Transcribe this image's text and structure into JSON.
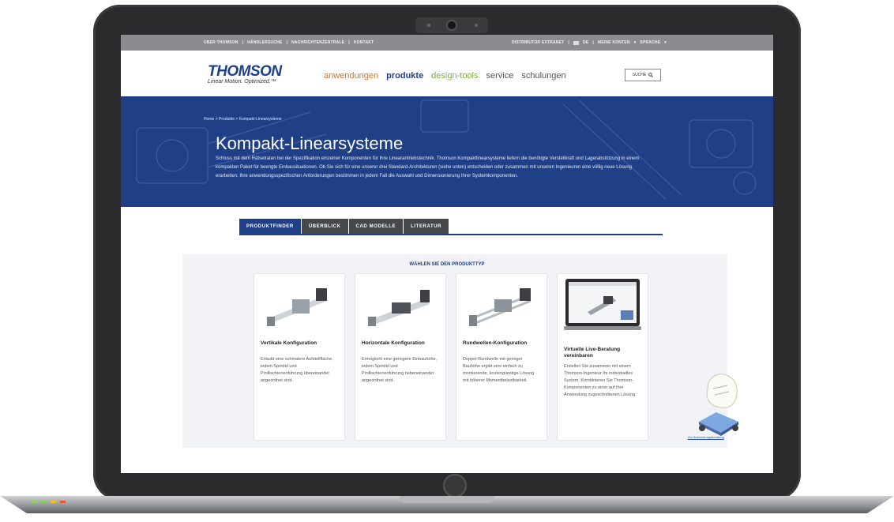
{
  "top_bar": {
    "left_links": [
      "ÜBER THOMSON",
      "HÄNDLERSUCHE",
      "NACHRICHTENZENTRALE",
      "KONTAKT"
    ],
    "right_links": [
      "DISTRIBUTOR EXTRANET",
      "DE",
      "MEINE KONTEN",
      "SPRACHE"
    ]
  },
  "header": {
    "logo": "THOMSON",
    "logo_tagline": "Linear Motion. Optimized.™",
    "nav": [
      {
        "label": "anwendungen",
        "color": "#e0711f"
      },
      {
        "label": "produkte",
        "color": "#1e3f8c"
      },
      {
        "label": "design-tools",
        "color": "#7bb23a"
      },
      {
        "label": "service",
        "color": "#555555"
      },
      {
        "label": "schulungen",
        "color": "#555555"
      }
    ],
    "search_label": "SUCHE"
  },
  "hero": {
    "breadcrumb": "Home > Produkte > Kompakt-Linearsysteme",
    "title": "Kompakt-Linearsysteme",
    "text": "Schluss mit dem Rätselraten bei der Spezifikation einzelner Komponenten für Ihre Linearantriebstechnik. Thomson Kompaktlinearsysteme liefern die benötigte Verstellkraft und Lagerabstützung in einem kompakten Paket für beengte Einbausituationen. Ob Sie sich für eine unserer drei Standard-Architekturen (siehe unten) entscheiden oder zusammen mit unseren Ingenieuren eine völlig neue Lösung erarbeiten: Ihre anwendungsspezifischen Anforderungen bestimmen in jedem Fall die Auswahl und Dimensionierung Ihrer Systemkomponenten."
  },
  "tabs": [
    "PRODUKTFINDER",
    "ÜBERBLICK",
    "CAD MODELLE",
    "LITERATUR"
  ],
  "active_tab_index": 0,
  "picker_title": "WÄHLEN SIE DEN PRODUKTTYP",
  "cards": [
    {
      "title": "Vertikale Konfiguration",
      "desc": "Erlaubt eine schmalere Aufstellfläche, indem Spindel und Profilschienenführung übereinander angeordnet sind."
    },
    {
      "title": "Horizontale Konfiguration",
      "desc": "Ermöglicht eine geringere Einbauhöhe, indem Spindel und Profilschienenführung nebeneinander angeordnet sind."
    },
    {
      "title": "Rundwellen-Konfiguration",
      "desc": "Doppel-Rundwelle mit geringer Bauhöhe ergibt eine einfach zu montierende, kostengünstige Lösung mit höherer Momentbelastbarkeit."
    },
    {
      "title": "Virtuelle Live-Beratung vereinbaren",
      "desc": "Erstellen Sie zusammen mit einem Thomson-Ingenieur Ihr individuelles System. Kombinieren Sie Thomson-Komponenten zu einer auf Ihre Anwendung zugeschnittenen Lösung."
    }
  ],
  "consult_link": "Zur Anwendungsberatung",
  "colors": {
    "brand_blue": "#1f3f87",
    "tab_dark": "#45474b",
    "topbar": "#8a8c8f"
  }
}
